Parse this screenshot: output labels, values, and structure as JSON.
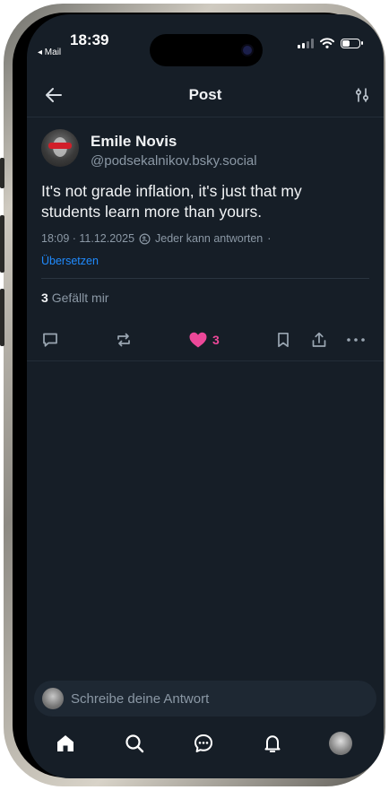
{
  "status_bar": {
    "time": "18:39",
    "back_app": "◂ Mail"
  },
  "header": {
    "title": "Post",
    "back_icon": "arrow-left-icon",
    "filter_icon": "sliders-icon"
  },
  "post": {
    "author_name": "Emile Novis",
    "author_handle": "@podsekalnikov.bsky.social",
    "text": "It's not grade inflation, it's just that my students learn more than yours.",
    "datetime": "18:09 · 11.12.2025",
    "reply_setting": "Jeder kann antworten",
    "meta_trailing_dot": "·",
    "translate_label": "Übersetzen",
    "like_count": "3",
    "likes_label": "Gefällt mir",
    "actions": {
      "reply_icon": "comment-icon",
      "repost_icon": "repost-icon",
      "like_icon": "heart-icon",
      "like_count": "3",
      "bookmark_icon": "bookmark-icon",
      "share_icon": "share-icon",
      "more_icon": "more-icon"
    }
  },
  "reply_bar": {
    "placeholder": "Schreibe deine Antwort"
  },
  "tab_bar": {
    "items": [
      "home-icon",
      "search-icon",
      "chat-icon",
      "bell-icon",
      "profile-avatar"
    ]
  },
  "colors": {
    "background": "#161e27",
    "accent_link": "#208bfe",
    "like": "#ec4899",
    "muted_text": "#8b98a5"
  }
}
